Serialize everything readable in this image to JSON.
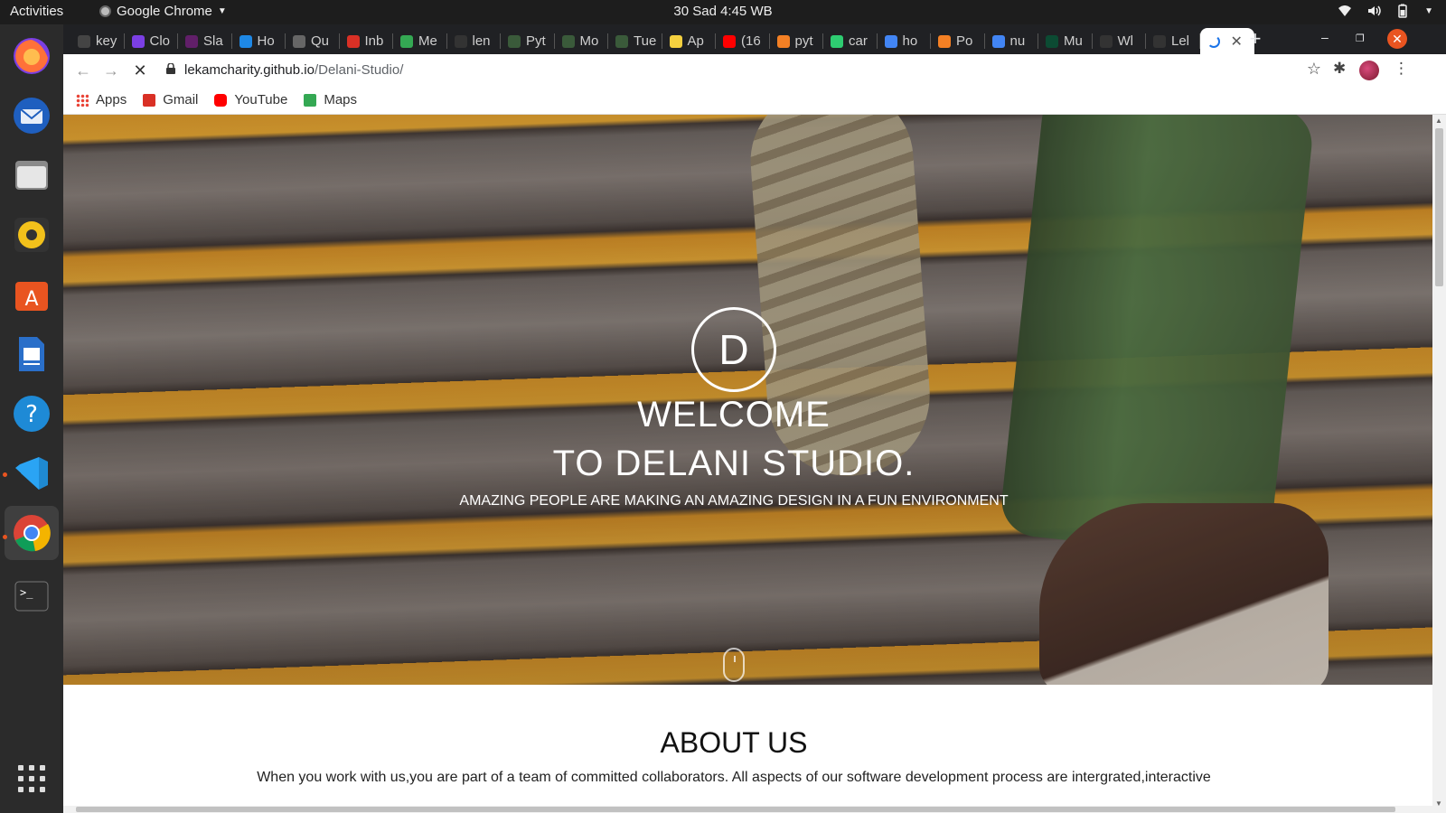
{
  "system": {
    "activities": "Activities",
    "app_name": "Google Chrome",
    "clock": "30 Sad  4:45 WB"
  },
  "dock": {
    "items": [
      "firefox",
      "thunderbird",
      "files",
      "rhythmbox",
      "software-center",
      "libreoffice-writer",
      "help",
      "vscode",
      "chrome",
      "terminal"
    ]
  },
  "tabs": [
    {
      "label": "key",
      "color": "#444"
    },
    {
      "label": "Clo",
      "color": "#7b3fe4"
    },
    {
      "label": "Sla",
      "color": "#611f69"
    },
    {
      "label": "Ho",
      "color": "#1e88e5"
    },
    {
      "label": "Qu",
      "color": "#666"
    },
    {
      "label": "Inb",
      "color": "#d93025"
    },
    {
      "label": "Me",
      "color": "#34a853"
    },
    {
      "label": "len",
      "color": "#333"
    },
    {
      "label": "Pyt",
      "color": "#3a5a3a"
    },
    {
      "label": "Mo",
      "color": "#3a5a3a"
    },
    {
      "label": "Tue",
      "color": "#3a5a3a"
    },
    {
      "label": "Ap",
      "color": "#f4d03f"
    },
    {
      "label": "(16",
      "color": "#ff0000"
    },
    {
      "label": "pyt",
      "color": "#f48024"
    },
    {
      "label": "car",
      "color": "#2ecc71"
    },
    {
      "label": "ho",
      "color": "#4285f4"
    },
    {
      "label": "Po",
      "color": "#f48024"
    },
    {
      "label": "nu",
      "color": "#4285f4"
    },
    {
      "label": "Mu",
      "color": "#0c4b33"
    },
    {
      "label": "Wl",
      "color": "#333"
    },
    {
      "label": "Lel",
      "color": "#333"
    }
  ],
  "active_tab": {
    "label": ""
  },
  "address": {
    "host": "lekamcharity.github.io",
    "path": "/Delani-Studio/"
  },
  "bookmarks": [
    {
      "label": "Apps",
      "color": "#e94235"
    },
    {
      "label": "Gmail",
      "color": "#d93025"
    },
    {
      "label": "YouTube",
      "color": "#ff0000"
    },
    {
      "label": "Maps",
      "color": "#34a853"
    }
  ],
  "hero": {
    "logo_letter": "D",
    "title_line1": "WELCOME",
    "title_line2": "TO DELANI STUDIO.",
    "subtitle": "AMAZING PEOPLE ARE MAKING AN AMAZING DESIGN IN A FUN ENVIRONMENT"
  },
  "about": {
    "title": "ABOUT US",
    "text": "When you work with us,you are part of a team of committed collaborators. All aspects of our software development process are intergrated,interactive"
  },
  "colors": {
    "accent_orange": "#e95420",
    "chrome_dark": "#202124"
  }
}
